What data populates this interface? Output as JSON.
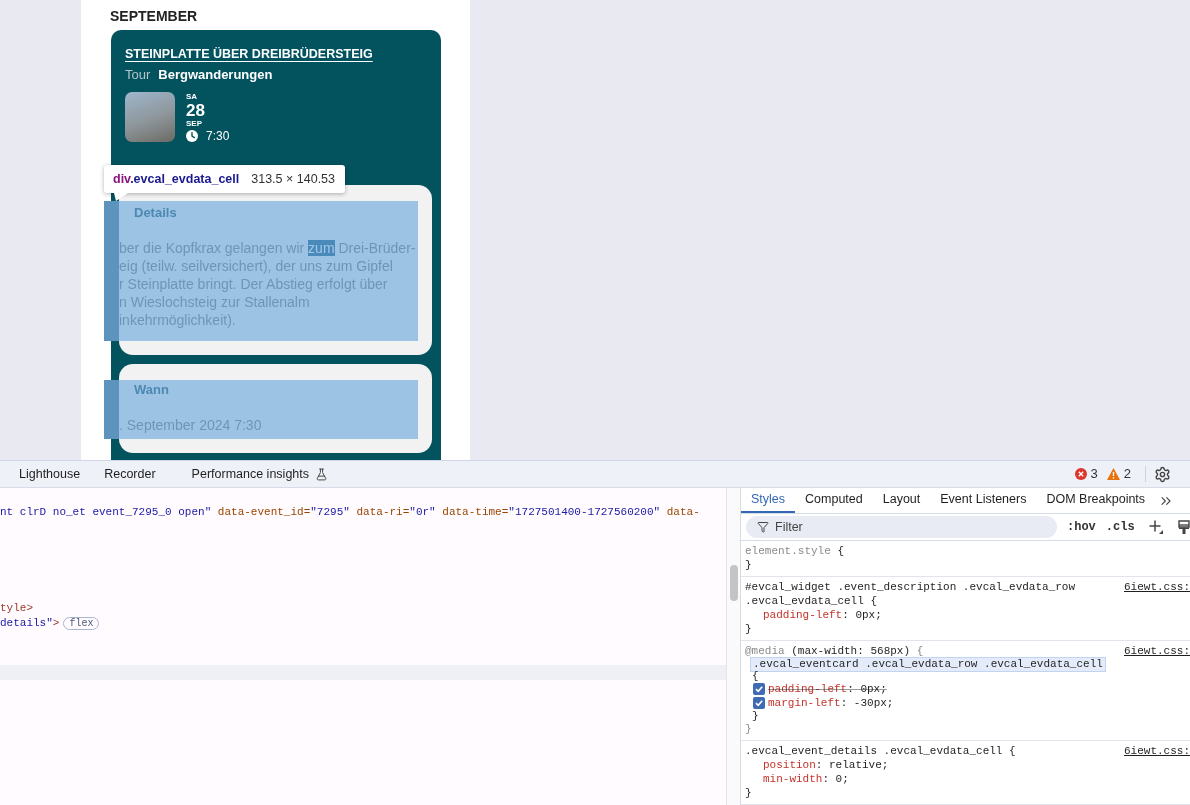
{
  "page": {
    "month_heading": "SEPTEMBER",
    "event": {
      "title": "STEINPLATTE ÜBER DREIBRÜDERSTEIG",
      "type_label": "Tour",
      "category": "Bergwanderungen",
      "date": {
        "weekday": "SA",
        "day": "28",
        "month": "SEP",
        "time": "7:30"
      },
      "sections": [
        {
          "heading": "Details",
          "inspected": true,
          "lines": [
            [
              {
                "text": "ber die Kopfkrax gelangen wir ",
                "highlighted": false
              },
              {
                "text": "zum",
                "highlighted": true
              },
              {
                "text": " Drei-Brüder-",
                "highlighted": false
              }
            ],
            [
              {
                "text": "eig (teilw. seilversichert), der uns zum Gipfel",
                "highlighted": false
              }
            ],
            [
              {
                "text": "r Steinplatte bringt. Der Abstieg erfolgt über",
                "highlighted": false
              }
            ],
            [
              {
                "text": "n Wieslochsteig zur Stallenalm",
                "highlighted": false
              }
            ],
            [
              {
                "text": "inkehrmöglichkeit).",
                "highlighted": false
              }
            ]
          ]
        },
        {
          "heading": "Wann",
          "inspected": true,
          "lines": [
            [
              {
                "text": ". September 2024 7:30",
                "highlighted": false
              }
            ]
          ]
        }
      ]
    },
    "inspector_tooltip": {
      "tag": "div",
      "class_name": ".evcal_evdata_cell",
      "size": "313.5 × 140.53"
    }
  },
  "devtools": {
    "tabs": [
      {
        "label": "Lighthouse",
        "selected": false,
        "experimental": false
      },
      {
        "label": "Recorder",
        "selected": false,
        "experimental": false
      },
      {
        "label": "Performance insights",
        "selected": false,
        "experimental": true
      }
    ],
    "issues": {
      "errors": "3",
      "warnings": "2"
    },
    "dom_tree": {
      "groups": [
        {
          "lines": [
            {
              "segments": [
                {
                  "text": "nt clrD no_et event_7295_0 open\"",
                  "kind": "value"
                },
                {
                  "text": " data-event_id=",
                  "kind": "attribute"
                },
                {
                  "text": "\"7295\"",
                  "kind": "value"
                },
                {
                  "text": " data-ri=",
                  "kind": "attribute"
                },
                {
                  "text": "\"0r\"",
                  "kind": "value"
                },
                {
                  "text": " data-time=",
                  "kind": "attribute"
                },
                {
                  "text": "\"1727501400-1727560200\"",
                  "kind": "value"
                },
                {
                  "text": " data-",
                  "kind": "attribute"
                }
              ]
            }
          ]
        },
        {
          "lines": [
            {
              "segments": [
                {
                  "text": "tyle>",
                  "kind": "tag"
                }
              ]
            },
            {
              "segments": [
                {
                  "text": "details\"",
                  "kind": "value"
                },
                {
                  "text": ">",
                  "kind": "tag"
                }
              ],
              "badge": "flex"
            }
          ]
        }
      ],
      "hovered_row": true
    },
    "styles_pane": {
      "tabs": [
        {
          "label": "Styles",
          "selected": true
        },
        {
          "label": "Computed",
          "selected": false
        },
        {
          "label": "Layout",
          "selected": false
        },
        {
          "label": "Event Listeners",
          "selected": false
        },
        {
          "label": "DOM Breakpoints",
          "selected": false
        }
      ],
      "filter": {
        "placeholder": "Filter"
      },
      "toggles": [
        ":hov",
        ".cls"
      ],
      "rules": [
        {
          "lines": [
            {
              "kind": "selector",
              "highlighted": false,
              "segments": [
                {
                  "text": "element.style",
                  "kind": "muted"
                },
                {
                  "text": " {",
                  "kind": "plain"
                }
              ]
            },
            {
              "kind": "brace",
              "segments": [
                {
                  "text": "}",
                  "kind": "plain"
                }
              ]
            }
          ]
        },
        {
          "source": "6iewt.css:",
          "lines": [
            {
              "kind": "selector",
              "highlighted": false,
              "segments": [
                {
                  "text": "#evcal_widget .event_description .evcal_evdata_row",
                  "kind": "plain"
                }
              ]
            },
            {
              "kind": "selector",
              "highlighted": false,
              "segments": [
                {
                  "text": ".evcal_evdata_cell {",
                  "kind": "plain"
                }
              ]
            },
            {
              "kind": "declaration",
              "overridden": false,
              "segments": [
                {
                  "text": "padding-left",
                  "kind": "property"
                },
                {
                  "text": ": 0px;",
                  "kind": "plain"
                }
              ]
            },
            {
              "kind": "brace",
              "segments": [
                {
                  "text": "}",
                  "kind": "plain"
                }
              ]
            }
          ]
        },
        {
          "source": "6iewt.css:",
          "lines": [
            {
              "kind": "selector",
              "highlighted": false,
              "segments": [
                {
                  "text": "@media",
                  "kind": "muted"
                },
                {
                  "text": " (max-width: 568px) ",
                  "kind": "plain"
                },
                {
                  "text": "{",
                  "kind": "muted"
                }
              ]
            },
            {
              "kind": "nested-selector",
              "highlighted": true,
              "segments": [
                {
                  "text": ".evcal_eventcard .evcal_evdata_row .evcal_evdata_cell",
                  "kind": "plain"
                }
              ]
            },
            {
              "kind": "nested-brace",
              "segments": [
                {
                  "text": "{",
                  "kind": "plain"
                }
              ]
            },
            {
              "kind": "nested-declaration",
              "checked": true,
              "overridden": true,
              "segments": [
                {
                  "text": "padding-left",
                  "kind": "property"
                },
                {
                  "text": ": 0px;",
                  "kind": "plain"
                }
              ]
            },
            {
              "kind": "nested-declaration",
              "checked": true,
              "overridden": false,
              "segments": [
                {
                  "text": "margin-left",
                  "kind": "property"
                },
                {
                  "text": ": -30px;",
                  "kind": "plain"
                }
              ]
            },
            {
              "kind": "nested-brace",
              "segments": [
                {
                  "text": "}",
                  "kind": "plain"
                }
              ]
            },
            {
              "kind": "brace",
              "segments": [
                {
                  "text": "}",
                  "kind": "muted"
                }
              ]
            }
          ]
        },
        {
          "source": "6iewt.css:",
          "lines": [
            {
              "kind": "selector",
              "highlighted": false,
              "segments": [
                {
                  "text": ".evcal_event_details .evcal_evdata_cell {",
                  "kind": "plain"
                }
              ]
            },
            {
              "kind": "declaration",
              "overridden": false,
              "segments": [
                {
                  "text": "position",
                  "kind": "property"
                },
                {
                  "text": ": relative;",
                  "kind": "plain"
                }
              ]
            },
            {
              "kind": "declaration",
              "overridden": false,
              "segments": [
                {
                  "text": "min-width",
                  "kind": "property"
                },
                {
                  "text": ": 0;",
                  "kind": "plain"
                }
              ]
            },
            {
              "kind": "brace",
              "segments": [
                {
                  "text": "}",
                  "kind": "plain"
                }
              ]
            }
          ]
        }
      ]
    }
  }
}
